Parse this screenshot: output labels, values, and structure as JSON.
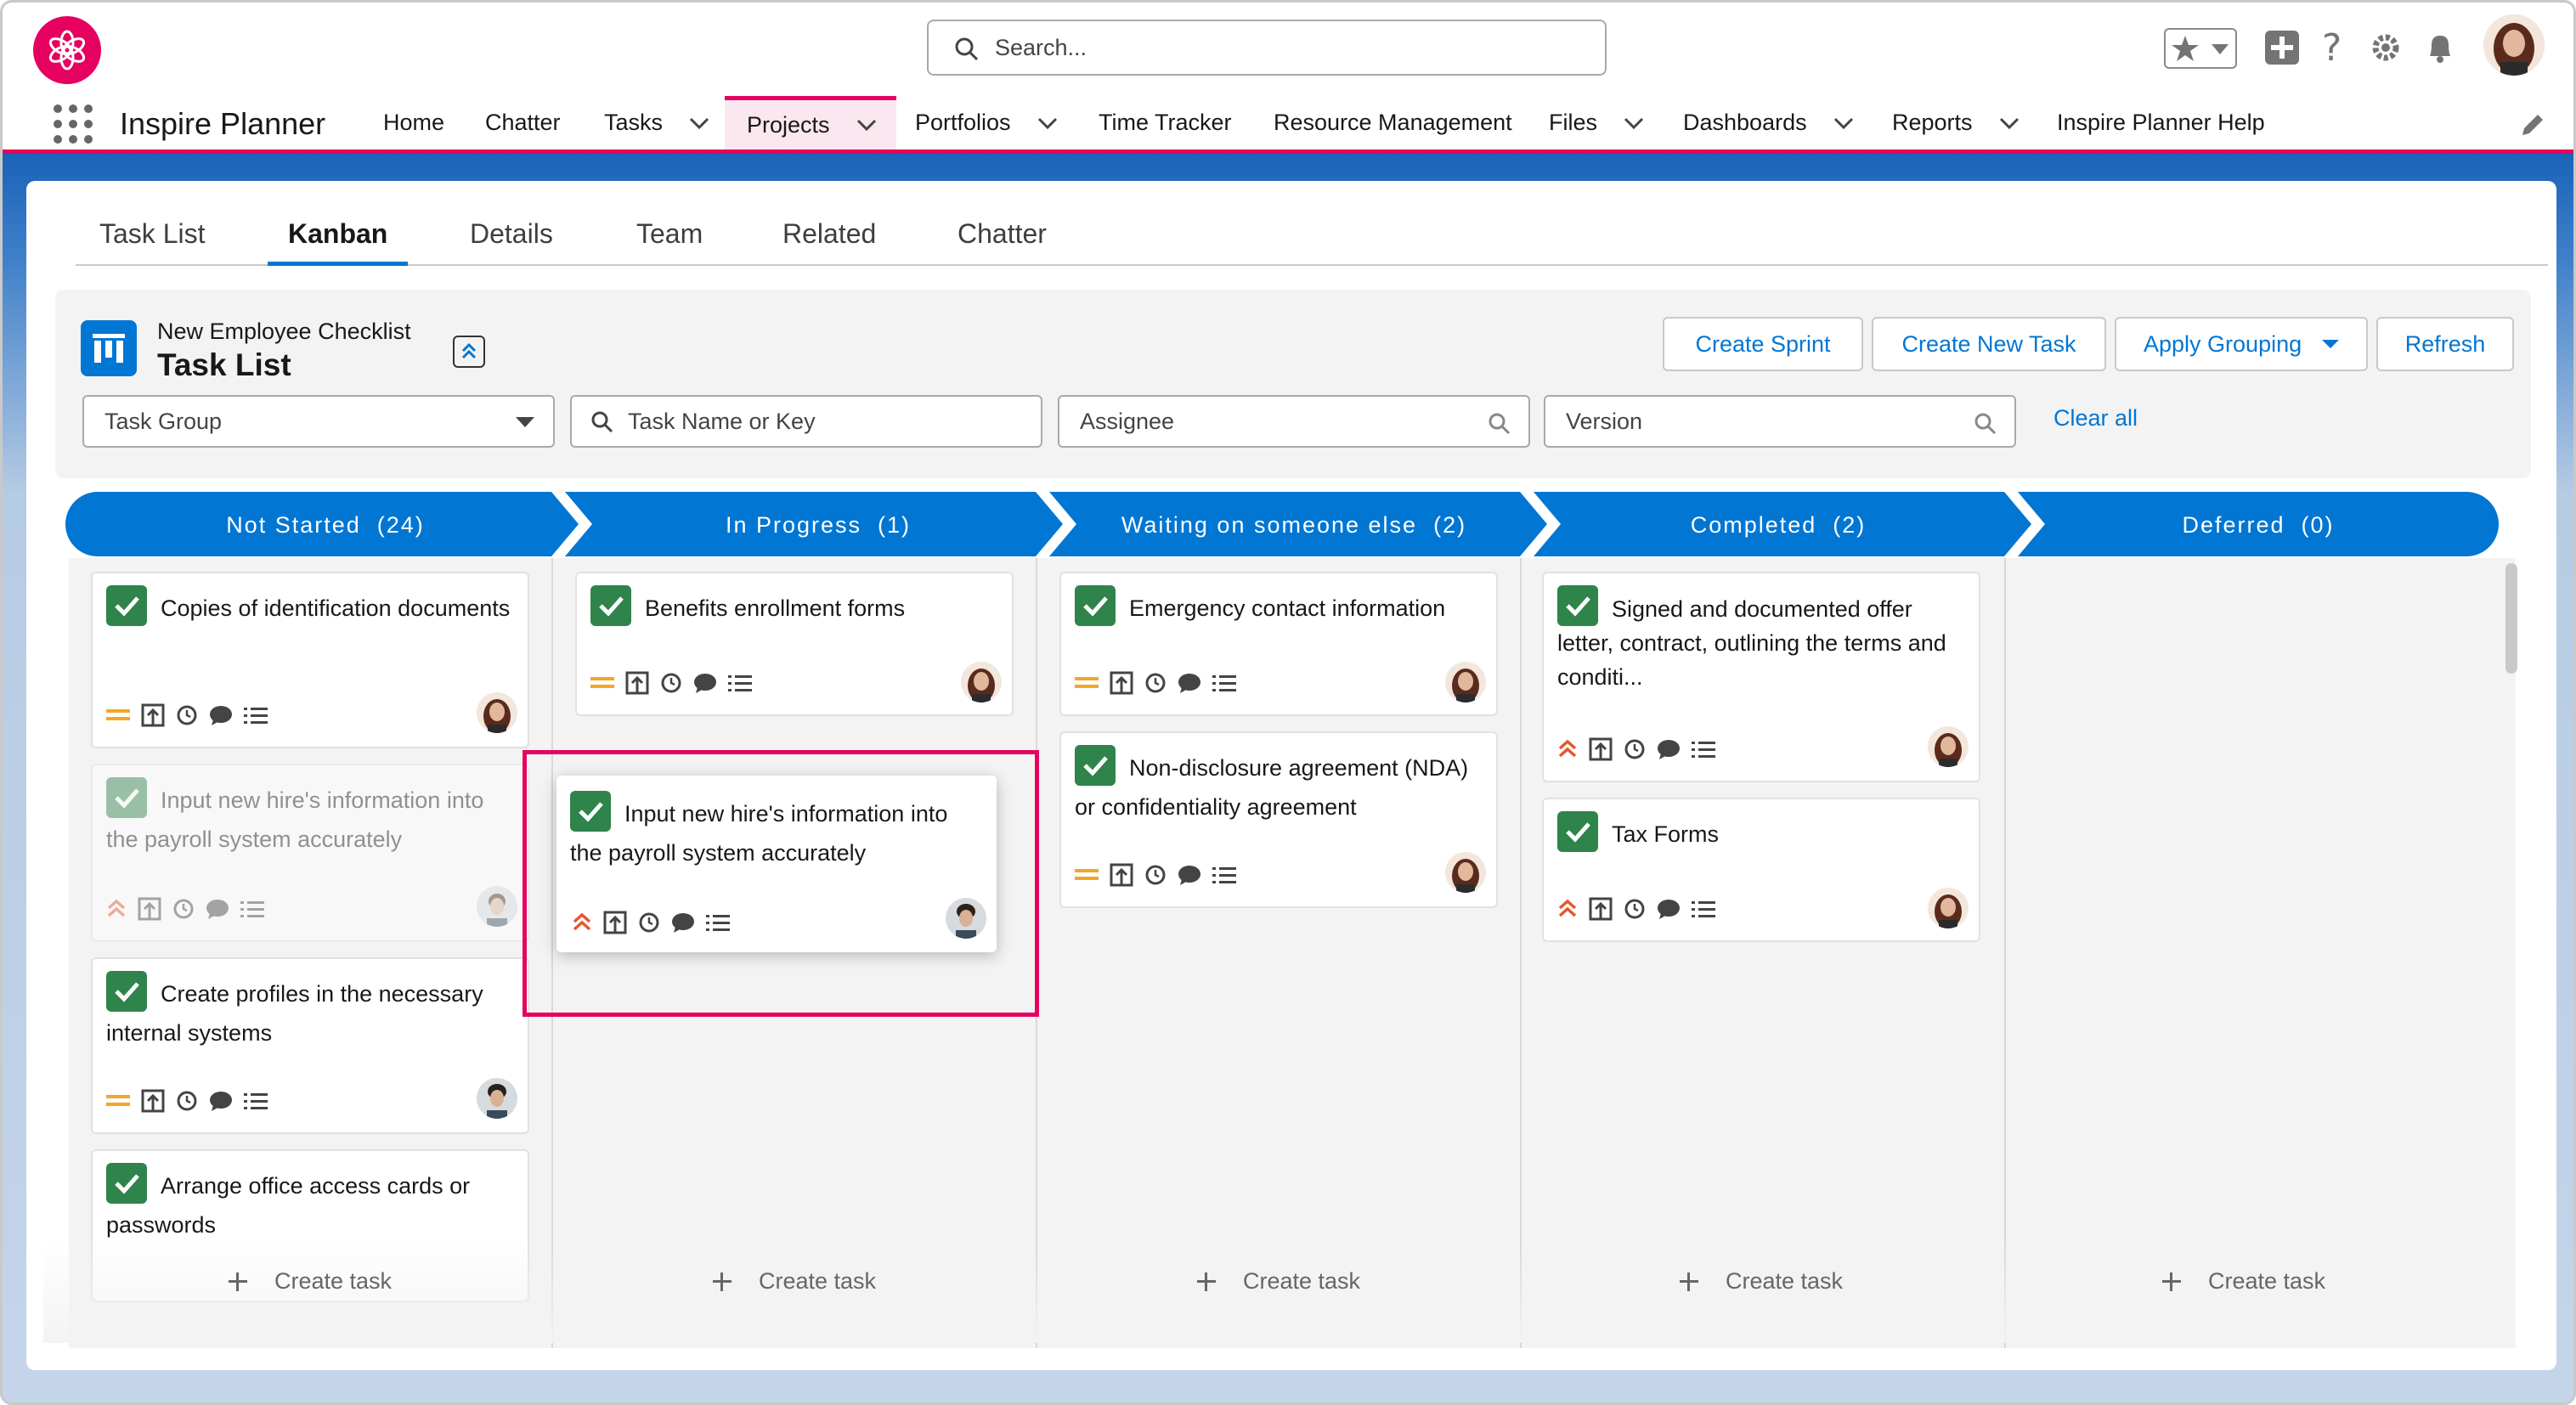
{
  "app": {
    "name": "Inspire Planner"
  },
  "search": {
    "placeholder": "Search..."
  },
  "nav": {
    "items": [
      {
        "label": "Home"
      },
      {
        "label": "Chatter"
      },
      {
        "label": "Tasks"
      },
      {
        "label": "Projects"
      },
      {
        "label": "Portfolios"
      },
      {
        "label": "Time Tracker"
      },
      {
        "label": "Resource Management"
      },
      {
        "label": "Files"
      },
      {
        "label": "Dashboards"
      },
      {
        "label": "Reports"
      },
      {
        "label": "Inspire Planner Help"
      }
    ],
    "active": "Projects"
  },
  "tabs": [
    {
      "label": "Task List"
    },
    {
      "label": "Kanban"
    },
    {
      "label": "Details"
    },
    {
      "label": "Team"
    },
    {
      "label": "Related"
    },
    {
      "label": "Chatter"
    }
  ],
  "active_tab": "Kanban",
  "panel": {
    "project_name": "New Employee Checklist",
    "title": "Task List",
    "buttons": {
      "create_sprint": "Create Sprint",
      "create_new_task": "Create New Task",
      "apply_grouping": "Apply Grouping",
      "refresh": "Refresh"
    },
    "filters": {
      "task_group": "Task Group",
      "task_name": "Task Name or Key",
      "assignee": "Assignee",
      "version": "Version",
      "clear_all": "Clear all"
    }
  },
  "columns": [
    {
      "label": "Not Started",
      "count": "(24)"
    },
    {
      "label": "In Progress",
      "count": "(1)"
    },
    {
      "label": "Waiting on someone else",
      "count": "(2)"
    },
    {
      "label": "Completed",
      "count": "(2)"
    },
    {
      "label": "Deferred",
      "count": "(0)"
    }
  ],
  "tasks": {
    "not_started": [
      {
        "title": "Copies of identification documents"
      },
      {
        "title": "Input new hire's information into the payroll system accurately"
      },
      {
        "title": "Create profiles in the necessary internal systems"
      },
      {
        "title": "Arrange office access cards or passwords"
      }
    ],
    "in_progress": [
      {
        "title": "Benefits enrollment forms"
      }
    ],
    "dragging": {
      "title": "Input new hire's information into the payroll system accurately"
    },
    "waiting": [
      {
        "title": "Emergency contact information"
      },
      {
        "title": "Non-disclosure agreement (NDA) or confidentiality agreement"
      }
    ],
    "completed": [
      {
        "title": "Signed and documented offer letter, contract, outlining the terms and conditi..."
      },
      {
        "title": "Tax Forms"
      }
    ]
  },
  "create_task_label": "Create task",
  "colors": {
    "brand": "#e4045f",
    "accent": "#0176d3",
    "done": "#2e844a",
    "medium_priority": "#f5a623",
    "high_priority": "#e4572e"
  }
}
